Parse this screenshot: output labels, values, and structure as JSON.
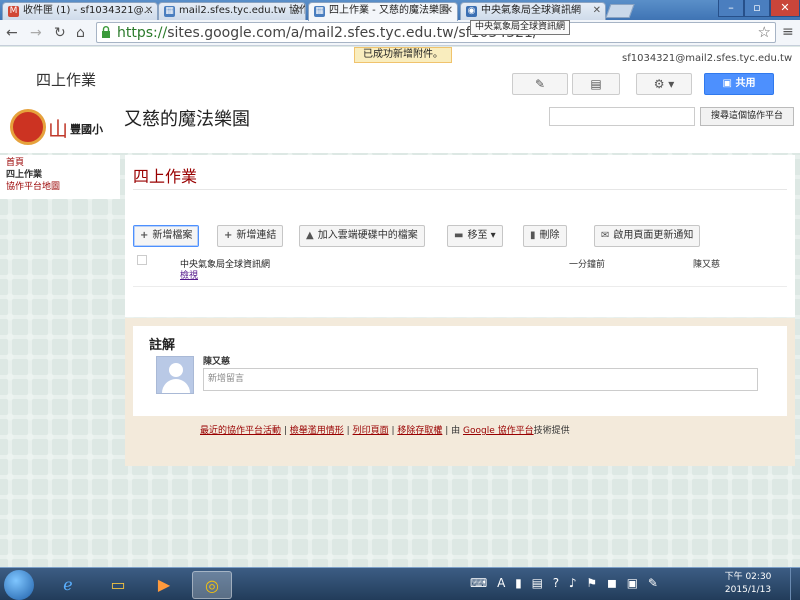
{
  "browser": {
    "tabs": [
      {
        "label": "收件匣 (1) - sf1034321@...",
        "favicon": "M",
        "color": "#d14836"
      },
      {
        "label": "mail2.sfes.tyc.edu.tw 協作...",
        "favicon": "▦",
        "color": "#4a7ebf"
      },
      {
        "label": "四上作業 - 又慈的魔法樂園",
        "favicon": "▦",
        "color": "#4a7ebf"
      },
      {
        "label": "中央氣象局全球資訊網",
        "favicon": "◉",
        "color": "#3b6fb3"
      }
    ],
    "url_scheme": "https://",
    "url_host": "sites.google.com",
    "url_path": "/a/mail2.sfes.tyc.edu.tw/sf1034321/",
    "tooltip": "中央氣象局全球資訊網"
  },
  "gsites": {
    "notice": "已成功新增附件。",
    "title": "四上作業",
    "user_email": "sf1034321@mail2.sfes.tyc.edu.tw",
    "share_label": "共用",
    "edit_icon": "pencil-icon",
    "newpage_icon": "new-page-icon",
    "settings_icon": "gear-icon"
  },
  "site": {
    "logo_char": "山",
    "school_name": "豐國小",
    "name": "又慈的魔法樂園",
    "search_button": "搜尋這個協作平台"
  },
  "sidebar": {
    "items": [
      "首頁",
      "四上作業",
      "協作平台地圖"
    ]
  },
  "page": {
    "title": "四上作業",
    "actions": [
      {
        "label": "新增檔案",
        "icon": "plus-icon",
        "glyph": "+"
      },
      {
        "label": "新增連結",
        "icon": "plus-icon",
        "glyph": "+"
      },
      {
        "label": "加入雲端硬碟中的檔案",
        "icon": "drive-icon",
        "glyph": "▲"
      },
      {
        "label": "移至",
        "icon": "folder-icon",
        "glyph": "▬"
      },
      {
        "label": "刪除",
        "icon": "trash-icon",
        "glyph": "▮"
      },
      {
        "label": "啟用頁面更新通知",
        "icon": "mail-icon",
        "glyph": "✉"
      }
    ],
    "file": {
      "name": "中央氣象局全球資訊網",
      "view_label": "檢視",
      "time": "一分鐘前",
      "user": "陳又慈"
    }
  },
  "comments": {
    "title": "註解",
    "user": "陳又慈",
    "placeholder": "新增留言"
  },
  "footer": {
    "links": [
      "最近的協作平台活動",
      "檢舉濫用情形",
      "列印頁面",
      "移除存取權"
    ],
    "provided_prefix": "由",
    "provider": "Google 協作平台",
    "provided_suffix": "技術提供"
  },
  "taskbar": {
    "time": "下午 02:30",
    "date": "2015/1/13",
    "tray": "⌨ A ▮ ▤ ? ♪ ⚑ ◼ ▣ ✎"
  }
}
